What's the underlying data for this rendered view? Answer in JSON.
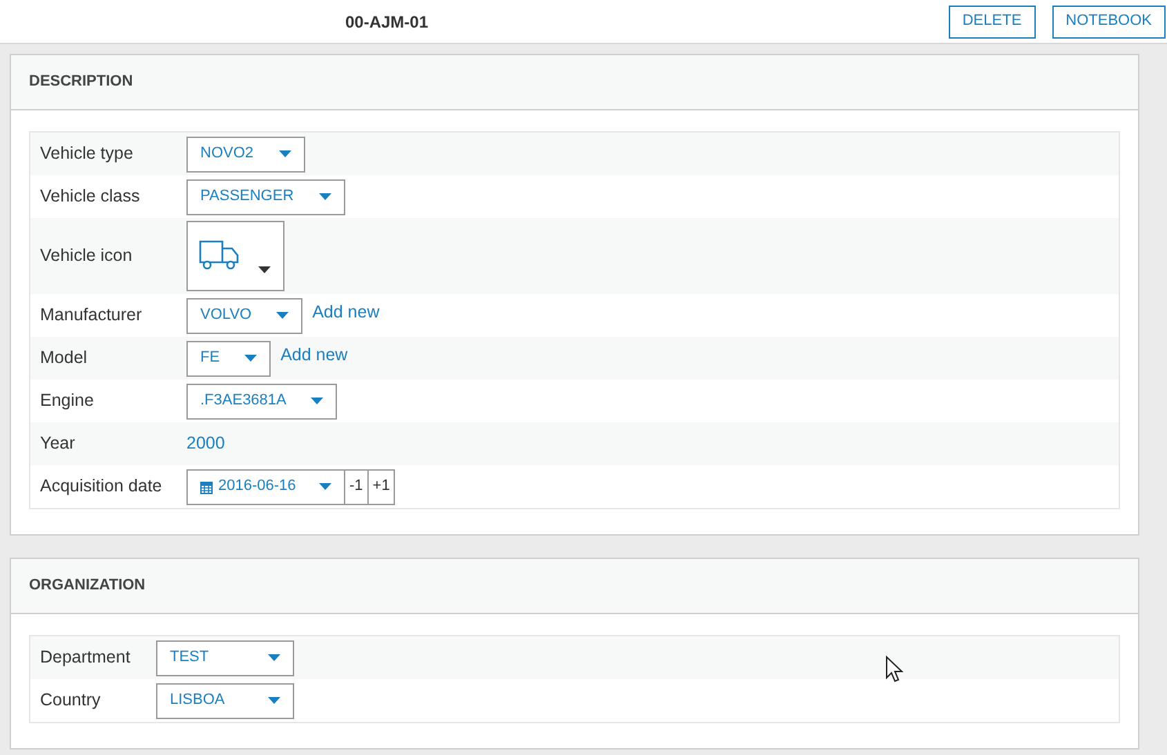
{
  "header": {
    "title": "00-AJM-01",
    "buttons": [
      "DELETE",
      "NOTEBOOK"
    ]
  },
  "sections": [
    {
      "title": "DESCRIPTION",
      "rows": [
        {
          "kind": "select",
          "label": "Vehicle type",
          "value": "NOVO2"
        },
        {
          "kind": "select",
          "label": "Vehicle class",
          "value": "PASSENGER"
        },
        {
          "kind": "icon_select",
          "label": "Vehicle icon"
        },
        {
          "kind": "select",
          "label": "Manufacturer",
          "value": "VOLVO",
          "link": "Add new"
        },
        {
          "kind": "select",
          "label": "Model",
          "value": "FE",
          "link": "Add new"
        },
        {
          "kind": "select",
          "label": "Engine",
          "value": ".F3AE3681A"
        },
        {
          "kind": "value",
          "label": "Year",
          "value": "2000"
        },
        {
          "kind": "date",
          "label": "Acquisition date",
          "value": "2016-06-16",
          "steps": [
            "-1",
            "+1"
          ]
        }
      ]
    },
    {
      "title": "ORGANIZATION",
      "rows": [
        {
          "kind": "select",
          "label": "Department",
          "value": "TEST"
        },
        {
          "kind": "select",
          "label": "Country",
          "value": "LISBOA"
        }
      ]
    }
  ]
}
